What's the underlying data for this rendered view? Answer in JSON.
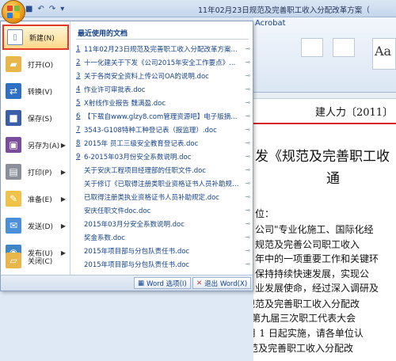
{
  "window": {
    "title": "11年02月23日规范及完善职工收入分配改革方案（"
  },
  "ribbon": {
    "acrobat_tab": "Acrobat",
    "style_sample": "Aa"
  },
  "office_menu": {
    "commands": [
      {
        "label": "新建(N)",
        "icon": "new-document-icon",
        "selected": true,
        "has_submenu": false
      },
      {
        "label": "打开(O)",
        "icon": "open-folder-icon",
        "selected": false,
        "has_submenu": false
      },
      {
        "label": "转换(V)",
        "icon": "convert-icon",
        "selected": false,
        "has_submenu": false
      },
      {
        "label": "保存(S)",
        "icon": "save-icon",
        "selected": false,
        "has_submenu": false
      },
      {
        "label": "另存为(A)",
        "icon": "save-as-icon",
        "selected": false,
        "has_submenu": true
      },
      {
        "label": "打印(P)",
        "icon": "print-icon",
        "selected": false,
        "has_submenu": true
      },
      {
        "label": "准备(E)",
        "icon": "prepare-icon",
        "selected": false,
        "has_submenu": true
      },
      {
        "label": "发送(D)",
        "icon": "send-icon",
        "selected": false,
        "has_submenu": true
      },
      {
        "label": "发布(U)",
        "icon": "publish-icon",
        "selected": false,
        "has_submenu": true
      },
      {
        "label": "关闭(C)",
        "icon": "close-folder-icon",
        "selected": false,
        "has_submenu": false
      }
    ],
    "recent_title": "最近使用的文档",
    "recent_docs": [
      {
        "num": "1",
        "name": "11年02月23日规范及完善职工收入分配改革方案..."
      },
      {
        "num": "2",
        "name": "十一化建关于下发《公司2015年安全工作要点》..."
      },
      {
        "num": "3",
        "name": "关于各岗安全资料上传公司OA的说明.doc"
      },
      {
        "num": "4",
        "name": "作业许可审批表.doc"
      },
      {
        "num": "5",
        "name": "X射线作业报告 魏满盈.doc"
      },
      {
        "num": "6",
        "name": "【下载自www.glzy8.com管理资源吧】电子版摘..."
      },
      {
        "num": "7",
        "name": "3543-G108特种工种登记表（报监理）.doc"
      },
      {
        "num": "8",
        "name": "2015年 员工三级安全教育登记表.doc"
      },
      {
        "num": "9",
        "name": "6-2015年03月份安全系数说明.doc"
      },
      {
        "num": "",
        "name": "关于安庆工程项目经理部的任职文件.doc"
      },
      {
        "num": "",
        "name": "关于修订《已取得注册类职业资格证书人员补助规定..."
      },
      {
        "num": "",
        "name": "已取得注册类执业资格证书人员补助规定.doc"
      },
      {
        "num": "",
        "name": "安庆任职文件doc.doc"
      },
      {
        "num": "",
        "name": "2015年03月分安全系数说明.doc"
      },
      {
        "num": "",
        "name": "奖金系数.doc"
      },
      {
        "num": "",
        "name": "2015年项目部与分包队责任书.doc"
      },
      {
        "num": "",
        "name": "2015年项目部与分包队责任书.doc"
      }
    ],
    "word_options_label": "Word 选项(I)",
    "exit_word_label": "退出 Word(X)"
  },
  "document": {
    "issuer": "建人力〔2011〕",
    "title_line1": "发《规范及完善职工收",
    "title_line2": "通",
    "lines": [
      "位：",
      "公司\"专业化施工、国际化经",
      "规范及完善公司职工收入",
      "年中的一项重要工作和关键环",
      "保持持续快速发展，实现公",
      "业发展使命，经过深入调研及",
      "究制定的《规范及完善职工收入分配改",
      "27 日经公司第九届三次职工代表大会",
      "2011 年 3 月 1 日起实施，请各单位认",
      "附：《规范及完善职工收入分配改"
    ]
  },
  "colors": {
    "accent": "#15428b",
    "selected_border": "#e43a2c",
    "rule_red": "#dd2222"
  }
}
